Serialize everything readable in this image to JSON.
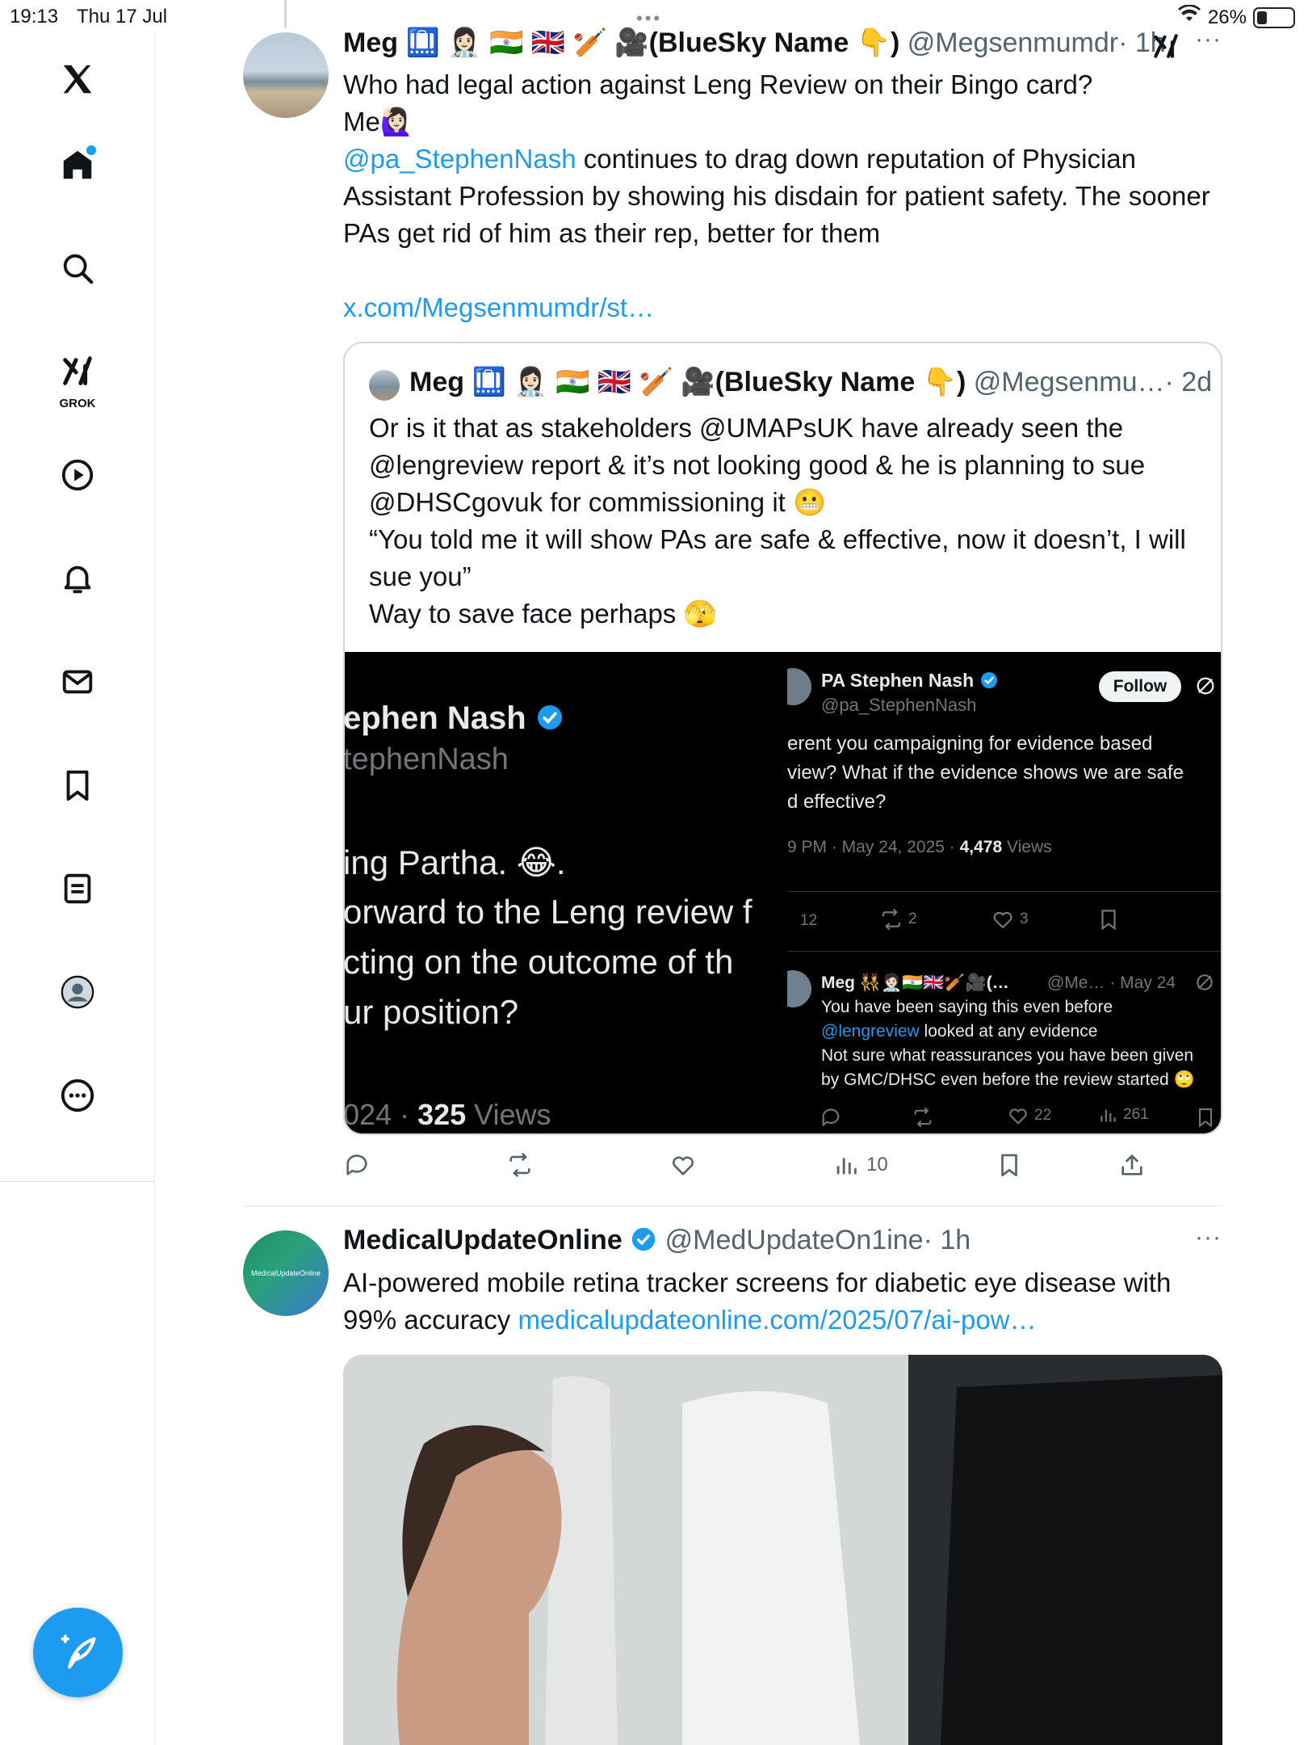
{
  "status_bar": {
    "time": "19:13",
    "date": "Thu 17 Jul",
    "battery": "26%"
  },
  "sidebar": {
    "grok_label": "GROK"
  },
  "tweet1": {
    "name": "Meg 🛄 👩🏻‍⚕️ 🇮🇳 🇬🇧 🏏 🎥(BlueSky Name 👇)",
    "handle": "@Megsenmumdr",
    "time": "· 1h",
    "line1": "Who had legal action against Leng Review on their Bingo card?",
    "line2": "Me🙋🏻‍♀️",
    "mention": "@pa_StephenNash",
    "line3_rest": " continues to drag down reputation of Physician Assistant Profession by showing his disdain for patient safety. The sooner PAs get rid of him as their  rep, better for them",
    "link": "x.com/Megsenmumdr/st…",
    "quote": {
      "name": "Meg 🛄 👩🏻‍⚕️ 🇮🇳 🇬🇧 🏏 🎥(BlueSky Name 👇)",
      "handle": "@Megsenmu…",
      "time": "· 2d",
      "text1": "Or is it that as stakeholders @UMAPsUK have already seen the @lengreview report & it’s not looking good & he is planning to sue @DHSCgovuk for commissioning it 😬",
      "text2": "“You told me it will show PAs are safe & effective, now it doesn’t, I will sue you”",
      "text3": "Way to save face perhaps 🫣",
      "left_image": {
        "name": "ephen Nash",
        "handle": "tephenNash",
        "l1": "ing Partha. 😂.",
        "l2": "orward to the Leng review f",
        "l3": "cting on the outcome of th",
        "l4": "ur position?",
        "footer_pre": "024 · ",
        "views_num": "325",
        "views_label": " Views"
      },
      "right_image": {
        "name": "PA Stephen Nash",
        "handle": "@pa_StephenNash",
        "follow": "Follow",
        "t1": "erent you campaigning for evidence based",
        "t2": "view? What if the evidence shows we are safe",
        "t3": "d effective?",
        "meta_pre": "9 PM · May 24, 2025 · ",
        "meta_views": "4,478",
        "meta_label": " Views",
        "replies": "12",
        "reposts": "2",
        "likes": "3",
        "reply_name": "Meg 👯🧑🏻‍⚕️🇮🇳🇬🇧🏏🎥(…",
        "reply_handle": "@Me… · May 24",
        "r1": "You have been saying this even before",
        "r2_mention": "@lengreview",
        "r2_rest": " looked at any evidence",
        "r3": "Not sure what reassurances you have been given",
        "r4": "by GMC/DHSC even before the review started 🙄",
        "r_likes": "22",
        "r_views": "261"
      }
    },
    "views": "10"
  },
  "tweet2": {
    "name": "MedicalUpdateOnline",
    "handle": "@MedUpdateOn1ine",
    "time": "· 1h",
    "text": "AI-powered mobile retina tracker screens for diabetic eye disease with 99% accuracy ",
    "link": "medicalupdateonline.com/2025/07/ai-pow…",
    "avatar_text": "MedicalUpdateOnline"
  },
  "colors": {
    "accent": "#1d9bf0",
    "text": "#0f1419",
    "muted": "#536471"
  }
}
